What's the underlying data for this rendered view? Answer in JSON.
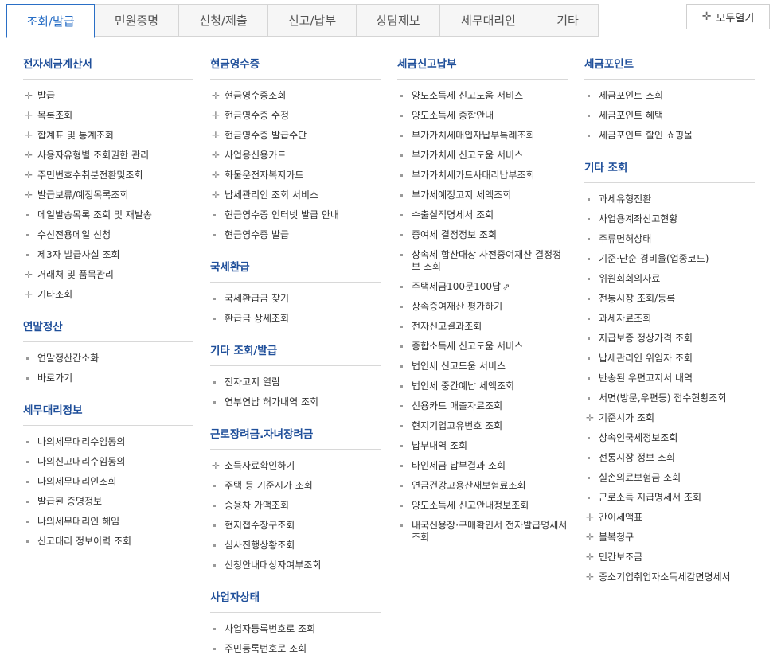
{
  "tabs": [
    "조회/발급",
    "민원증명",
    "신청/제출",
    "신고/납부",
    "상담제보",
    "세무대리인",
    "기타"
  ],
  "expand_all_label": "모두열기",
  "columns": [
    {
      "sections": [
        {
          "title": "전자세금계산서",
          "items": [
            {
              "label": "발급",
              "marker": "plus"
            },
            {
              "label": "목록조회",
              "marker": "plus"
            },
            {
              "label": "합계표 및 통계조회",
              "marker": "plus"
            },
            {
              "label": "사용자유형별 조회권한 관리",
              "marker": "plus"
            },
            {
              "label": "주민번호수취분전환및조회",
              "marker": "plus"
            },
            {
              "label": "발급보류/예정목록조회",
              "marker": "plus"
            },
            {
              "label": "메일발송목록 조회 및 재발송",
              "marker": "dot"
            },
            {
              "label": "수신전용메일 신청",
              "marker": "dot"
            },
            {
              "label": "제3자 발급사실 조회",
              "marker": "dot"
            },
            {
              "label": "거래처 및 품목관리",
              "marker": "plus"
            },
            {
              "label": "기타조회",
              "marker": "plus"
            }
          ]
        },
        {
          "title": "연말정산",
          "items": [
            {
              "label": "연말정산간소화",
              "marker": "dot"
            },
            {
              "label": "바로가기",
              "marker": "dot"
            }
          ]
        },
        {
          "title": "세무대리정보",
          "items": [
            {
              "label": "나의세무대리수임동의",
              "marker": "dot"
            },
            {
              "label": "나의신고대리수임동의",
              "marker": "dot"
            },
            {
              "label": "나의세무대리인조회",
              "marker": "dot"
            },
            {
              "label": "발급된 증명정보",
              "marker": "dot"
            },
            {
              "label": "나의세무대리인 해임",
              "marker": "dot"
            },
            {
              "label": "신고대리 정보이력 조회",
              "marker": "dot"
            }
          ]
        }
      ]
    },
    {
      "sections": [
        {
          "title": "현금영수증",
          "items": [
            {
              "label": "현금영수증조회",
              "marker": "plus"
            },
            {
              "label": "현금영수증 수정",
              "marker": "plus"
            },
            {
              "label": "현금영수증 발급수단",
              "marker": "plus"
            },
            {
              "label": "사업용신용카드",
              "marker": "plus"
            },
            {
              "label": "화물운전자복지카드",
              "marker": "plus"
            },
            {
              "label": "납세관리인 조회 서비스",
              "marker": "plus"
            },
            {
              "label": "현금영수증 인터넷 발급 안내",
              "marker": "dot"
            },
            {
              "label": "현금영수증 발급",
              "marker": "dot"
            }
          ]
        },
        {
          "title": "국세환급",
          "items": [
            {
              "label": "국세환급금 찾기",
              "marker": "dot"
            },
            {
              "label": "환급금 상세조회",
              "marker": "dot"
            }
          ]
        },
        {
          "title": "기타 조회/발급",
          "items": [
            {
              "label": "전자고지 열람",
              "marker": "dot"
            },
            {
              "label": "연부연납 허가내역 조회",
              "marker": "dot"
            }
          ]
        },
        {
          "title": "근로장려금.자녀장려금",
          "items": [
            {
              "label": "소득자료확인하기",
              "marker": "plus"
            },
            {
              "label": "주택 등 기준시가 조회",
              "marker": "dot"
            },
            {
              "label": "승용차 가액조회",
              "marker": "dot"
            },
            {
              "label": "현지접수창구조회",
              "marker": "dot"
            },
            {
              "label": "심사진행상황조회",
              "marker": "dot"
            },
            {
              "label": "신청안내대상자여부조회",
              "marker": "dot"
            }
          ]
        },
        {
          "title": "사업자상태",
          "items": [
            {
              "label": "사업자등록번호로 조회",
              "marker": "dot"
            },
            {
              "label": "주민등록번호로 조회",
              "marker": "dot"
            }
          ]
        }
      ]
    },
    {
      "sections": [
        {
          "title": "세금신고납부",
          "items": [
            {
              "label": "양도소득세 신고도움 서비스",
              "marker": "dot"
            },
            {
              "label": "양도소득세 종합안내",
              "marker": "dot"
            },
            {
              "label": "부가가치세매입자납부특례조회",
              "marker": "dot"
            },
            {
              "label": "부가가치세 신고도움 서비스",
              "marker": "dot"
            },
            {
              "label": "부가가치세카드사대리납부조회",
              "marker": "dot"
            },
            {
              "label": "부가세예정고지 세액조회",
              "marker": "dot"
            },
            {
              "label": "수출실적명세서 조회",
              "marker": "dot"
            },
            {
              "label": "증여세 결정정보 조회",
              "marker": "dot"
            },
            {
              "label": "상속세 합산대상 사전증여재산 결정정보 조회",
              "marker": "dot"
            },
            {
              "label": "주택세금100문100답",
              "marker": "dot",
              "external": "⇗"
            },
            {
              "label": "상속증여재산 평가하기",
              "marker": "dot"
            },
            {
              "label": "전자신고결과조회",
              "marker": "dot"
            },
            {
              "label": "종합소득세 신고도움 서비스",
              "marker": "dot"
            },
            {
              "label": "법인세 신고도움 서비스",
              "marker": "dot"
            },
            {
              "label": "법인세 중간예납 세액조회",
              "marker": "dot"
            },
            {
              "label": "신용카드 매출자료조회",
              "marker": "dot"
            },
            {
              "label": "현지기업고유번호 조회",
              "marker": "dot"
            },
            {
              "label": "납부내역 조회",
              "marker": "dot"
            },
            {
              "label": "타인세금 납부결과 조회",
              "marker": "dot"
            },
            {
              "label": "연금건강고용산재보험료조회",
              "marker": "dot"
            },
            {
              "label": "양도소득세 신고안내정보조회",
              "marker": "dot"
            },
            {
              "label": "내국신용장·구매확인서 전자발급명세서 조회",
              "marker": "dot"
            }
          ]
        }
      ]
    },
    {
      "sections": [
        {
          "title": "세금포인트",
          "items": [
            {
              "label": "세금포인트 조회",
              "marker": "dot"
            },
            {
              "label": "세금포인트 혜택",
              "marker": "dot"
            },
            {
              "label": "세금포인트 할인 쇼핑몰",
              "marker": "dot"
            }
          ]
        },
        {
          "title": "기타 조회",
          "items": [
            {
              "label": "과세유형전환",
              "marker": "dot"
            },
            {
              "label": "사업용계좌신고현황",
              "marker": "dot"
            },
            {
              "label": "주류면허상태",
              "marker": "dot"
            },
            {
              "label": "기준·단순 경비율(업종코드)",
              "marker": "dot"
            },
            {
              "label": "위원회회의자료",
              "marker": "dot"
            },
            {
              "label": "전통시장 조회/등록",
              "marker": "dot"
            },
            {
              "label": "과세자료조회",
              "marker": "dot"
            },
            {
              "label": "지급보증 정상가격 조회",
              "marker": "dot"
            },
            {
              "label": "납세관리인 위임자 조회",
              "marker": "dot"
            },
            {
              "label": "반송된 우편고지서 내역",
              "marker": "dot"
            },
            {
              "label": "서면(방문,우편등) 접수현황조회",
              "marker": "dot"
            },
            {
              "label": "기준시가 조회",
              "marker": "plus"
            },
            {
              "label": "상속인국세정보조회",
              "marker": "dot"
            },
            {
              "label": "전통시장 정보 조회",
              "marker": "dot"
            },
            {
              "label": "실손의료보험금 조회",
              "marker": "dot"
            },
            {
              "label": "근로소득 지급명세서 조회",
              "marker": "dot"
            },
            {
              "label": "간이세액표",
              "marker": "plus"
            },
            {
              "label": "불복청구",
              "marker": "plus"
            },
            {
              "label": "민간보조금",
              "marker": "plus"
            },
            {
              "label": "중소기업취업자소득세감면명세서",
              "marker": "plus"
            }
          ]
        }
      ]
    }
  ]
}
